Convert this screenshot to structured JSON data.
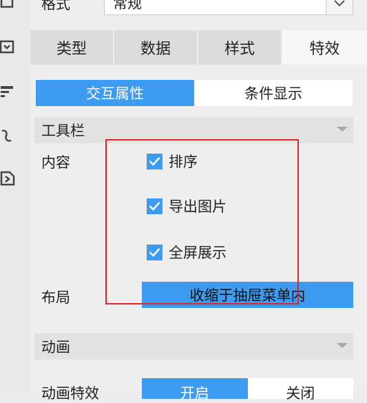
{
  "format": {
    "label": "格式",
    "value": "常规"
  },
  "tabs": [
    {
      "label": "类型",
      "active": false
    },
    {
      "label": "数据",
      "active": false
    },
    {
      "label": "样式",
      "active": false
    },
    {
      "label": "特效",
      "active": true
    }
  ],
  "subtabs": [
    {
      "label": "交互属性",
      "active": true
    },
    {
      "label": "条件显示",
      "active": false
    }
  ],
  "toolbar_group": {
    "title": "工具栏",
    "content_label": "内容",
    "options": [
      {
        "label": "排序",
        "checked": true
      },
      {
        "label": "导出图片",
        "checked": true
      },
      {
        "label": "全屏展示",
        "checked": true
      }
    ],
    "layout_label": "布局",
    "layout_value": "收缩于抽屉菜单内"
  },
  "animation_group": {
    "title": "动画",
    "effect_label": "动画特效",
    "toggle": {
      "on": "开启",
      "off": "关闭"
    }
  },
  "colors": {
    "accent": "#3d9cf2",
    "highlight_box": "#e32222"
  },
  "icons": [
    "square-icon",
    "dropdown-box-icon",
    "text-format-icon",
    "link-icon",
    "import-icon"
  ]
}
